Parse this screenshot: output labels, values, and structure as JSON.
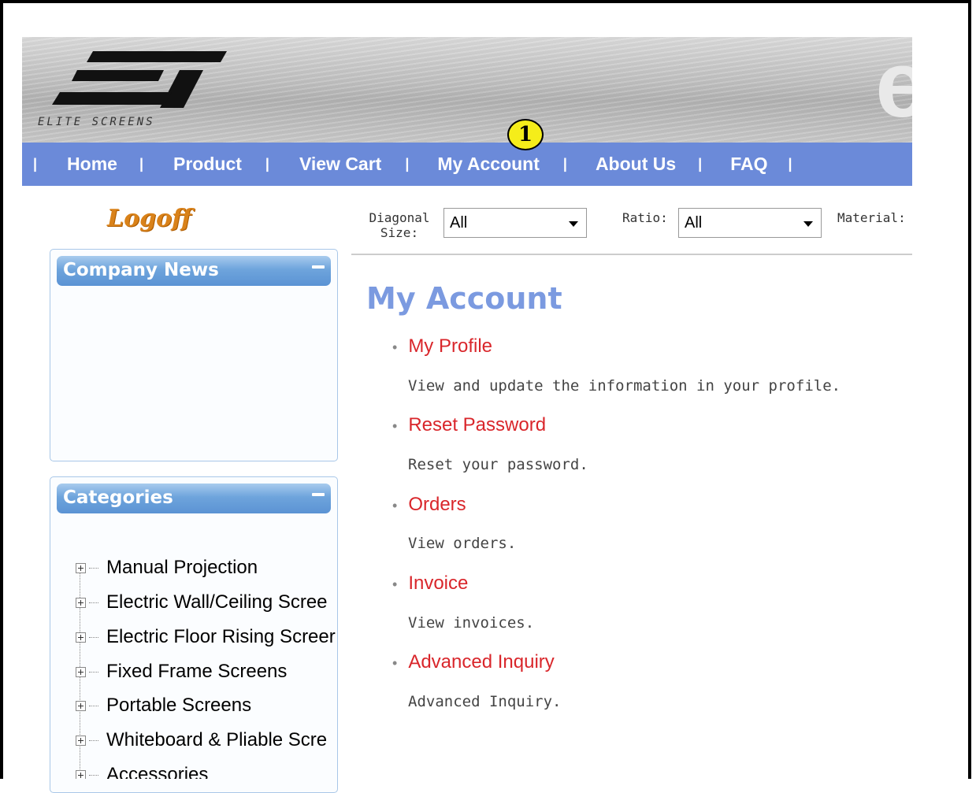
{
  "banner": {
    "logo_text": "ELITE SCREENS",
    "big_letter": "e"
  },
  "nav": {
    "items": [
      "Home",
      "Product",
      "View Cart",
      "My Account",
      "About Us",
      "FAQ"
    ],
    "separator": "|"
  },
  "marker": {
    "label": "1",
    "color": "#f5ed1a"
  },
  "logoff": "Logoff",
  "sidebar": {
    "company_news": {
      "title": "Company News"
    },
    "categories": {
      "title": "Categories",
      "items": [
        "Manual Projection",
        "Electric Wall/Ceiling Scree",
        "Electric Floor Rising Screer",
        "Fixed Frame Screens",
        "Portable Screens",
        "Whiteboard & Pliable Scre",
        "Accessories"
      ]
    }
  },
  "filters": {
    "diagonal_label": "Diagonal Size:",
    "diagonal_line1": "Diagonal",
    "diagonal_line2": "Size:",
    "diagonal_value": "All",
    "ratio_label": "Ratio:",
    "ratio_value": "All",
    "material_label": "Material:"
  },
  "main": {
    "title": "My Account",
    "links": [
      {
        "label": "My Profile",
        "desc": "View and update the information in your profile."
      },
      {
        "label": "Reset Password",
        "desc": "Reset your password."
      },
      {
        "label": "Orders",
        "desc": "View orders."
      },
      {
        "label": "Invoice",
        "desc": "View invoices."
      },
      {
        "label": "Advanced Inquiry",
        "desc": "Advanced Inquiry."
      }
    ]
  },
  "colors": {
    "nav_bg": "#6b8ad9",
    "link": "#d9262b",
    "heading": "#7b9ae0",
    "logoff": "#d9821a"
  }
}
